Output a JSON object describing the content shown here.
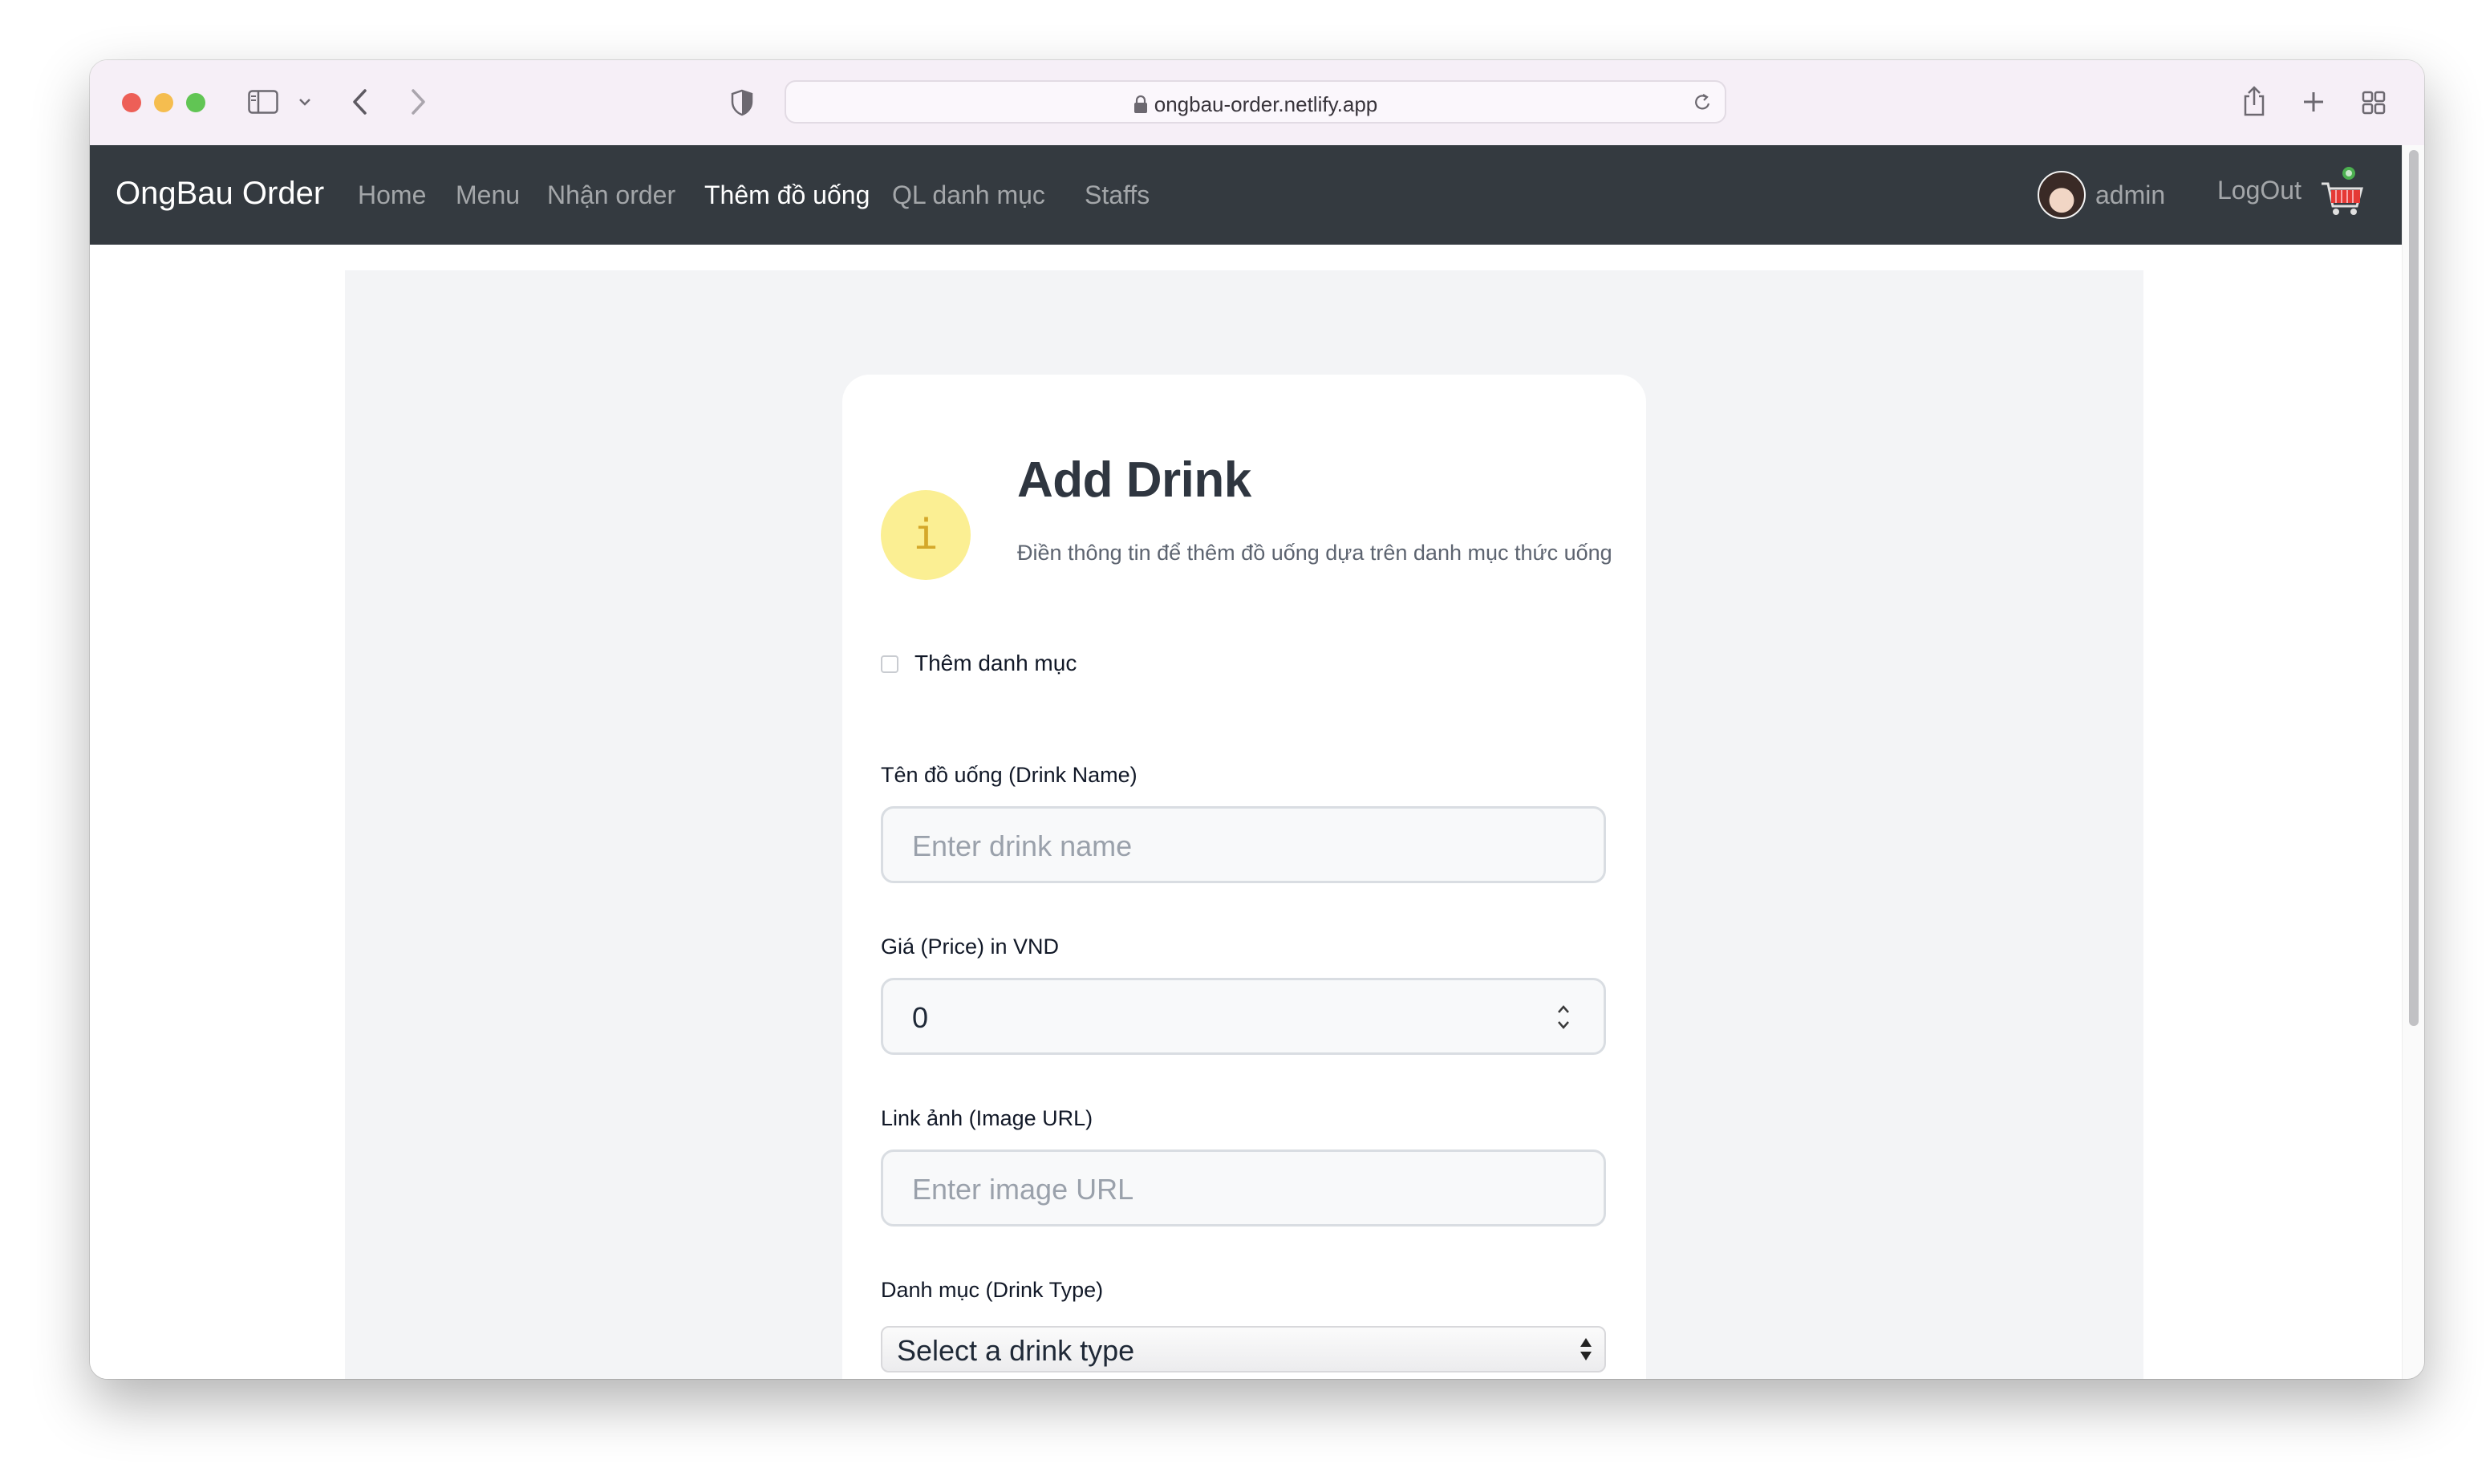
{
  "browser": {
    "url": "ongbau-order.netlify.app"
  },
  "navbar": {
    "brand": "OngBau Order",
    "links": [
      "Home",
      "Menu",
      "Nhận order",
      "Thêm đồ uống",
      "QL danh mục",
      "Staffs"
    ],
    "active_link": "Thêm đồ uống",
    "user_name": "admin",
    "logout_label": "LogOut"
  },
  "form": {
    "info_glyph": "i",
    "title": "Add Drink",
    "subtitle": "Điền thông tin để thêm đồ uống dựa trên danh mục thức uống",
    "add_category_label": "Thêm danh mục",
    "add_category_checked": false,
    "drink_name": {
      "label": "Tên đồ uống (Drink Name)",
      "placeholder": "Enter drink name",
      "value": ""
    },
    "price": {
      "label": "Giá (Price) in VND",
      "value": "0"
    },
    "image_url": {
      "label": "Link ảnh (Image URL)",
      "placeholder": "Enter image URL",
      "value": ""
    },
    "drink_type": {
      "label": "Danh mục (Drink Type)",
      "selected": "Select a drink type"
    }
  },
  "colors": {
    "navbar_bg": "#343a40",
    "info_circle_bg": "#fbef93",
    "info_glyph": "#d4a82a",
    "panel_bg": "#f3f4f6"
  }
}
